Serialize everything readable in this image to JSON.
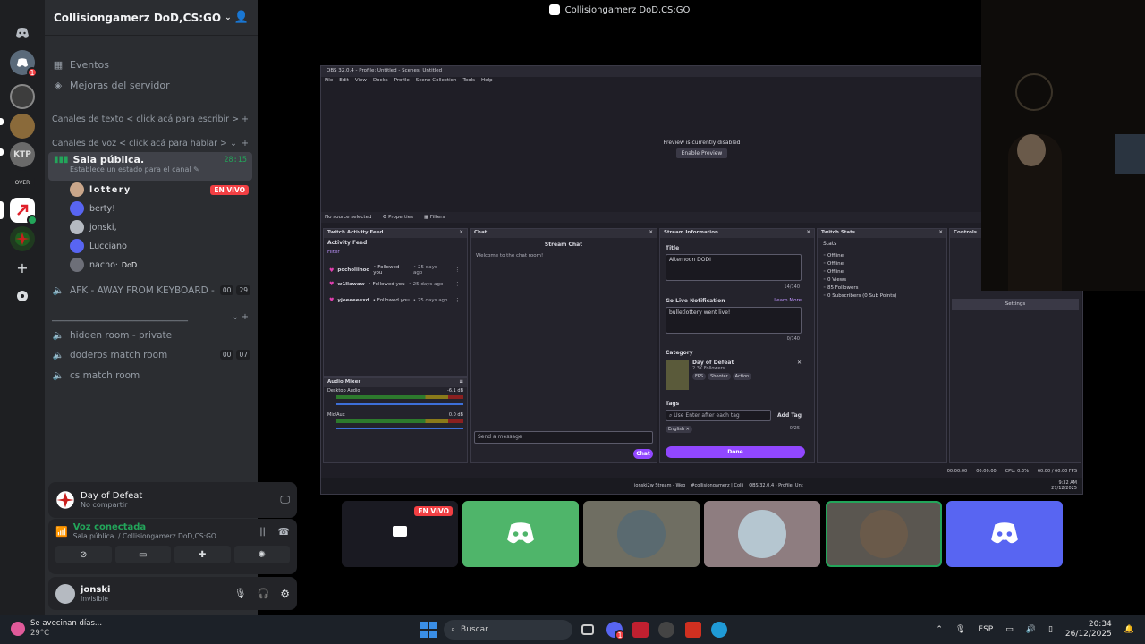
{
  "window_title": "Collisiongamerz DoD,CS:GO",
  "sidebar": {
    "server_name": "Collisiongamerz DoD,CS:GO",
    "events": "Eventos",
    "boosts": "Mejoras del servidor",
    "text_category": "Canales de texto < click acá para escribir >",
    "voice_category": "Canales de voz < click acá para hablar >",
    "active_channel": {
      "name": "Sala pública.",
      "status": "Establece un estado para el canal",
      "timer": "28:15"
    },
    "voice_users": [
      {
        "name": "lottery",
        "live": "EN VIVO",
        "color": "#c9a68a"
      },
      {
        "name": "berty!",
        "color": "#5865f2"
      },
      {
        "name": "jonski,",
        "color": "#b5bac1"
      },
      {
        "name": "Lucciano",
        "color": "#5865f2"
      },
      {
        "name": "nacho·",
        "tag": "DoD",
        "color": "#6d6f78"
      }
    ],
    "afk": {
      "name": "AFK - AWAY FROM KEYBOARD -",
      "count_a": "00",
      "count_b": "29"
    },
    "divider": "________________________________",
    "channels": [
      {
        "name": "hidden room - private"
      },
      {
        "name": "doderos match room",
        "count_a": "00",
        "count_b": "07"
      },
      {
        "name": "cs match room"
      }
    ]
  },
  "activity": {
    "game": "Day of Defeat",
    "sub": "No compartir"
  },
  "voice_panel": {
    "title": "Voz conectada",
    "sub": "Sala pública. / Collisiongamerz DoD,CS:GO"
  },
  "user_panel": {
    "name": "jonski",
    "status": "Invisible"
  },
  "obs": {
    "title": "OBS 32.0.4 - Profile: Untitled - Scenes: Untitled",
    "menu": [
      "File",
      "Edit",
      "View",
      "Docks",
      "Profile",
      "Scene Collection",
      "Tools",
      "Help"
    ],
    "preview_text": "Preview is currently disabled",
    "enable_preview": "Enable Preview",
    "no_source": "No source selected",
    "properties": "Properties",
    "filters": "Filters",
    "activity_dock": "Twitch Activity Feed",
    "activity_title": "Activity Feed",
    "filter": "Filter",
    "follows": [
      {
        "user": "pocholiinoo",
        "text": "• Followed you",
        "time": "• 25 days ago"
      },
      {
        "user": "w1llawaw",
        "text": "• Followed you",
        "time": "• 25 days ago"
      },
      {
        "user": "yjeeeeeexd",
        "text": "• Followed you",
        "time": "• 25 days ago"
      }
    ],
    "chat_dock": "Chat",
    "stream_chat": "Stream Chat",
    "welcome": "Welcome to the chat room!",
    "send_placeholder": "Send a message",
    "chat_button": "Chat",
    "stream_info_dock": "Stream Information",
    "title_label": "Title",
    "title_value": "Afternoon DODI",
    "title_count": "14/140",
    "golive_label": "Go Live Notification",
    "learn_more": "Learn More",
    "golive_value": "bulletlottery went live!",
    "golive_count": "0/140",
    "category_label": "Category",
    "category_name": "Day of Defeat",
    "category_followers": "2.3K Followers",
    "category_tags": [
      "FPS",
      "Shooter",
      "Action"
    ],
    "tags_label": "Tags",
    "tags_placeholder": "Use Enter after each tag",
    "add_tag": "Add Tag",
    "tag_english": "English",
    "tags_count": "0/25",
    "done": "Done",
    "stats_dock": "Twitch Stats",
    "stats_title": "Stats",
    "stats": [
      "Offline",
      "Offline",
      "Offline",
      "0 Views",
      "85 Followers",
      "0 Subscribers (0 Sub Points)"
    ],
    "controls_dock": "Controls",
    "settings": "Settings",
    "audio_dock": "Audio Mixer",
    "desktop_audio": "Desktop Audio",
    "desktop_db": "-6.1 dB",
    "mic_aux": "Mic/Aux",
    "mic_db": "0.0 dB",
    "status_time1": "00:00:00",
    "status_time2": "00:00:00",
    "status_cpu": "CPU: 0.3%",
    "status_fps": "60.00 / 60.00 FPS",
    "inner_taskbar": [
      "jonski2w Stream - Web",
      "#collisiongamerz | Colli",
      "OBS 32.0.4 - Profile: Unt"
    ],
    "inner_clock_time": "9:32 AM",
    "inner_clock_date": "27/12/2025"
  },
  "tiles": {
    "live": "EN VIVO"
  },
  "taskbar": {
    "weather_title": "Se avecinan días...",
    "weather_temp": "29°C",
    "search": "Buscar",
    "lang": "ESP",
    "time": "20:34",
    "date": "26/12/2025",
    "discord_badge": "1"
  },
  "colors": {
    "accent": "#5865f2",
    "green": "#23a55a",
    "live": "#f23f43",
    "twitch": "#9147ff"
  }
}
